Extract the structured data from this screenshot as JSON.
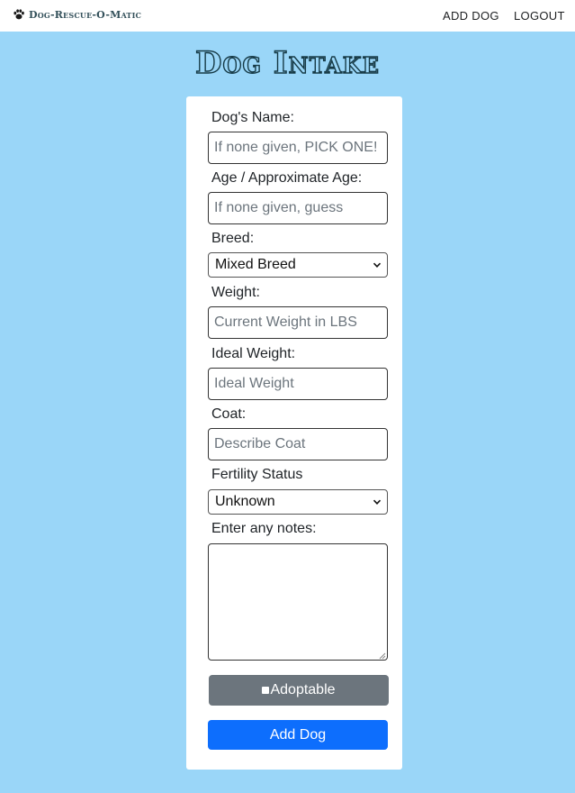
{
  "navbar": {
    "brand": "Dog-Rescue-O-Matic",
    "links": [
      "ADD DOG",
      "LOGOUT"
    ]
  },
  "page": {
    "title": "Dog Intake"
  },
  "form": {
    "name": {
      "label": "Dog's Name:",
      "placeholder": "If none given, PICK ONE!"
    },
    "age": {
      "label": "Age / Approximate Age:",
      "placeholder": "If none given, guess"
    },
    "breed": {
      "label": "Breed:",
      "selected": "Mixed Breed"
    },
    "weight": {
      "label": "Weight:",
      "placeholder": "Current Weight in LBS"
    },
    "ideal_weight": {
      "label": "Ideal Weight:",
      "placeholder": "Ideal Weight"
    },
    "coat": {
      "label": "Coat:",
      "placeholder": "Describe Coat"
    },
    "fertility": {
      "label": "Fertility Status",
      "selected": "Unknown"
    },
    "notes": {
      "label": "Enter any notes:"
    },
    "adoptable_label": "Adoptable",
    "submit_label": "Add Dog"
  },
  "colors": {
    "background": "#9ad6f8",
    "title_outline": "#163a46",
    "adoptable_button": "#6c757d",
    "submit_button": "#0d6efd"
  },
  "icons": {
    "brand": "paw-icon",
    "select": "chevron-down-icon"
  }
}
